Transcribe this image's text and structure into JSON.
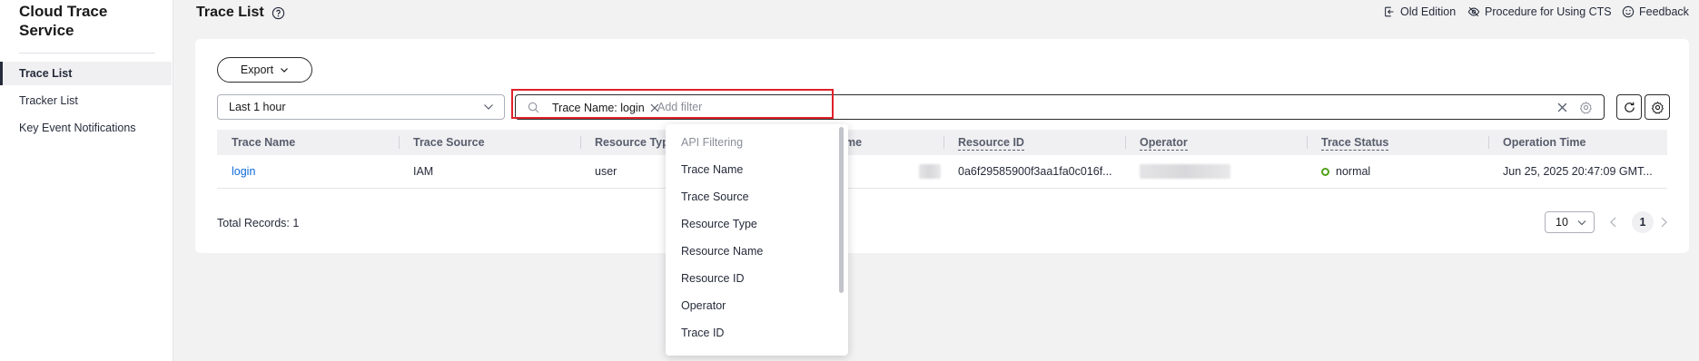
{
  "sidebar": {
    "title": "Cloud Trace Service",
    "items": [
      {
        "label": "Trace List"
      },
      {
        "label": "Tracker List"
      },
      {
        "label": "Key Event Notifications"
      }
    ]
  },
  "header": {
    "title": "Trace List",
    "links": {
      "old_edition": "Old Edition",
      "procedure": "Procedure for Using CTS",
      "feedback": "Feedback"
    }
  },
  "toolbar": {
    "export_label": "Export",
    "time_range": "Last 1 hour",
    "filter_tag": "Trace Name: login",
    "search_placeholder": "Add filter",
    "search_value": ""
  },
  "table": {
    "columns": [
      "Trace Name",
      "Trace Source",
      "Resource Typ",
      "me",
      "Resource ID",
      "Operator",
      "Trace Status",
      "Operation Time"
    ],
    "rows": [
      {
        "trace_name": "login",
        "trace_source": "IAM",
        "resource_type": "user",
        "resource_id": "0a6f29585900f3aa1fa0c016f...",
        "trace_status": "normal",
        "operation_time": "Jun 25, 2025 20:47:09 GMT..."
      }
    ]
  },
  "footer": {
    "total_records": "Total Records: 1",
    "page_size": "10",
    "current_page": "1"
  },
  "dropdown": {
    "group_label": "API Filtering",
    "items": [
      "Trace Name",
      "Trace Source",
      "Resource Type",
      "Resource Name",
      "Resource ID",
      "Operator",
      "Trace ID"
    ]
  },
  "colors": {
    "accent_link": "#0d6ad9",
    "status_normal": "#50a21a",
    "highlight_border": "#e0212a"
  }
}
